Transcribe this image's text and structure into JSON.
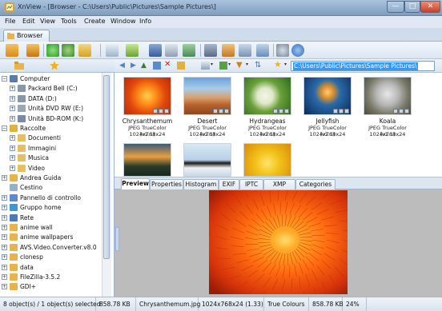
{
  "window": {
    "title": "XnView - [Browser - C:\\Users\\Public\\Pictures\\Sample Pictures\\]",
    "minimize": "—",
    "maximize": "□",
    "close": "✕"
  },
  "menu": [
    "File",
    "Edit",
    "View",
    "Tools",
    "Create",
    "Window",
    "Info"
  ],
  "tab": {
    "label": "Browser"
  },
  "toolbar_icons": [
    "browser-icon",
    "refresh-icon",
    "refresh-folder-icon",
    "rotate-icon",
    "open-icon",
    "convert-icon",
    "search-binoculars-icon",
    "print-icon",
    "acquire-icon",
    "slideshow-icon",
    "capture-icon",
    "webpage-icon",
    "batch-icon",
    "settings-icon",
    "about-icon"
  ],
  "left_panel": {
    "tabs": [
      "folders-tab-icon",
      "favorites-tab-icon"
    ],
    "tree": [
      {
        "label": "Computer",
        "level": 0,
        "icon": "computer-icon",
        "expander": "−"
      },
      {
        "label": "Packard Bell (C:)",
        "level": 1,
        "icon": "drive-icon",
        "expander": "+"
      },
      {
        "label": "DATA (D:)",
        "level": 1,
        "icon": "drive-icon",
        "expander": "+"
      },
      {
        "label": "Unità DVD RW (E:)",
        "level": 1,
        "icon": "dvd-icon",
        "expander": "+"
      },
      {
        "label": "Unità BD-ROM (K:)",
        "level": 1,
        "icon": "bd-icon",
        "expander": "+"
      },
      {
        "label": "Raccolte",
        "level": 0,
        "icon": "library-icon",
        "expander": "−"
      },
      {
        "label": "Documenti",
        "level": 1,
        "icon": "documents-icon",
        "expander": "+"
      },
      {
        "label": "Immagini",
        "level": 1,
        "icon": "pictures-icon",
        "expander": "+"
      },
      {
        "label": "Musica",
        "level": 1,
        "icon": "music-icon",
        "expander": "+"
      },
      {
        "label": "Video",
        "level": 1,
        "icon": "video-icon",
        "expander": "+"
      },
      {
        "label": "Andrea Guida",
        "level": 0,
        "icon": "user-folder-icon",
        "expander": "+"
      },
      {
        "label": "Cestino",
        "level": 0,
        "icon": "recycle-bin-icon",
        "expander": ""
      },
      {
        "label": "Pannello di controllo",
        "level": 0,
        "icon": "control-panel-icon",
        "expander": "+"
      },
      {
        "label": "Gruppo home",
        "level": 0,
        "icon": "homegroup-icon",
        "expander": "+"
      },
      {
        "label": "Rete",
        "level": 0,
        "icon": "network-icon",
        "expander": "+"
      },
      {
        "label": "anime wall",
        "level": 0,
        "icon": "folder-icon",
        "expander": "+"
      },
      {
        "label": "anime wallpapers",
        "level": 0,
        "icon": "folder-icon",
        "expander": "+"
      },
      {
        "label": "AVS.Video.Converter.v8.0",
        "level": 0,
        "icon": "folder-icon",
        "expander": "+"
      },
      {
        "label": "clonesp",
        "level": 0,
        "icon": "folder-icon",
        "expander": "+"
      },
      {
        "label": "data",
        "level": 0,
        "icon": "folder-icon",
        "expander": "+"
      },
      {
        "label": "FileZilla-3.5.2",
        "level": 0,
        "icon": "folder-icon",
        "expander": "+"
      },
      {
        "label": "GDI+",
        "level": 0,
        "icon": "folder-icon",
        "expander": "+"
      }
    ]
  },
  "address": {
    "path": "C:\\Users\\Public\\Pictures\\Sample Pictures\\"
  },
  "thumbnails": [
    {
      "name": "Chrysanthemum",
      "info": "JPEG TrueColor (v1.1)",
      "size": "1024x768x24"
    },
    {
      "name": "Desert",
      "info": "JPEG TrueColor (v1.1)",
      "size": "1024x768x24"
    },
    {
      "name": "Hydrangeas",
      "info": "JPEG TrueColor (v1.1)",
      "size": "1024x768x24"
    },
    {
      "name": "Jellyfish",
      "info": "JPEG TrueColor (v1.1)",
      "size": "1024x768x24"
    },
    {
      "name": "Koala",
      "info": "JPEG TrueColor (v1.1)",
      "size": "1024x768x24"
    },
    {
      "name": "",
      "info": "",
      "size": ""
    },
    {
      "name": "",
      "info": "",
      "size": ""
    },
    {
      "name": "",
      "info": "",
      "size": ""
    }
  ],
  "preview_tabs": [
    "Preview",
    "Properties",
    "Histogram",
    "EXIF",
    "IPTC",
    "XMP",
    "Categories"
  ],
  "status": {
    "objects": "8 object(s) / 1 object(s) selected",
    "size": "858.78 KB",
    "file": "Chrysanthemum.jpg",
    "dims": "1024x768x24 (1.33)",
    "colours": "True Colours",
    "filesize": "858.78 KB",
    "zoom": "24%"
  },
  "colors": {
    "title_bar": "#8fabca",
    "selection": "#3399ff",
    "close_button": "#c7402a"
  }
}
